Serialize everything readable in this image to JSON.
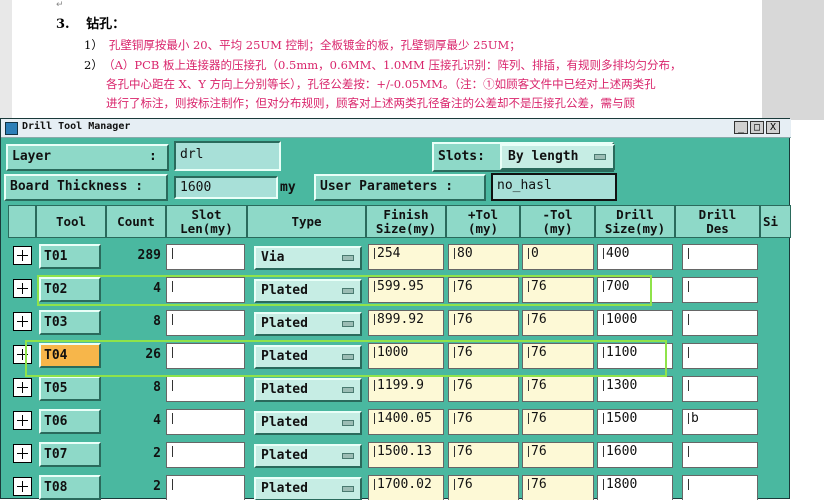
{
  "document": {
    "heading_number": "3.",
    "heading": "钻孔：",
    "lines": [
      {
        "num": "1）",
        "text": "孔壁铜厚按最小 20、平均 25UM 控制；全板镀金的板，孔壁铜厚最少 25UM；"
      },
      {
        "num": "2）",
        "text": "（A）PCB 板上连接器的压接孔（0.5mm，0.6MM、1.0MM 压接孔识别：阵列、排插，有规则多排均匀分布，"
      },
      {
        "num": "",
        "text": "各孔中心距在 X、Y 方向上分别等长），孔径公差按：+/-0.05MM。（注：①如顾客文件中已经对上述两类孔"
      },
      {
        "num": "",
        "text": "进行了标注，则按标注制作；但对分布规则，顾客对上述两类孔径备注的公差却不是压接孔公差，需与顾"
      }
    ]
  },
  "window": {
    "title": "Drill Tool Manager",
    "buttons": {
      "minimize": "_",
      "maximize": "□",
      "close": "X"
    }
  },
  "form": {
    "layer_label": "Layer",
    "layer_sep": ":",
    "layer_value": "drl",
    "slots_label": "Slots:",
    "slots_value": "By length",
    "board_thickness_label": "Board Thickness :",
    "board_thickness_value": "1600",
    "board_thickness_unit": "my",
    "user_params_label": "User Parameters :",
    "user_params_value": "no_hasl"
  },
  "table": {
    "headers": [
      "Tool",
      "Count",
      "Slot\nLen(my)",
      "Type",
      "Finish\nSize(my)",
      "+Tol\n(my)",
      "-Tol\n(my)",
      "Drill\nSize(my)",
      "Drill\nDes",
      "Si"
    ],
    "rows": [
      {
        "tool": "T01",
        "count": "289",
        "slot": "",
        "type": "Via",
        "finish": "254",
        "ptol": "80",
        "ntol": "0",
        "drill": "400",
        "des": ""
      },
      {
        "tool": "T02",
        "count": "4",
        "slot": "",
        "type": "Plated",
        "finish": "599.95",
        "ptol": "76",
        "ntol": "76",
        "drill": "700",
        "des": ""
      },
      {
        "tool": "T03",
        "count": "8",
        "slot": "",
        "type": "Plated",
        "finish": "899.92",
        "ptol": "76",
        "ntol": "76",
        "drill": "1000",
        "des": ""
      },
      {
        "tool": "T04",
        "count": "26",
        "slot": "",
        "type": "Plated",
        "finish": "1000",
        "ptol": "76",
        "ntol": "76",
        "drill": "1100",
        "des": ""
      },
      {
        "tool": "T05",
        "count": "8",
        "slot": "",
        "type": "Plated",
        "finish": "1199.9",
        "ptol": "76",
        "ntol": "76",
        "drill": "1300",
        "des": ""
      },
      {
        "tool": "T06",
        "count": "4",
        "slot": "",
        "type": "Plated",
        "finish": "1400.05",
        "ptol": "76",
        "ntol": "76",
        "drill": "1500",
        "des": "b"
      },
      {
        "tool": "T07",
        "count": "2",
        "slot": "",
        "type": "Plated",
        "finish": "1500.13",
        "ptol": "76",
        "ntol": "76",
        "drill": "1600",
        "des": ""
      },
      {
        "tool": "T08",
        "count": "2",
        "slot": "",
        "type": "Plated",
        "finish": "1700.02",
        "ptol": "76",
        "ntol": "76",
        "drill": "1800",
        "des": ""
      }
    ],
    "selected_tool": "T04"
  },
  "colors": {
    "window_bg": "#4ab8a0",
    "selected_tool": "#f7b64a",
    "highlight_box": "#8fe34a",
    "doc_text": "#d9246b"
  }
}
